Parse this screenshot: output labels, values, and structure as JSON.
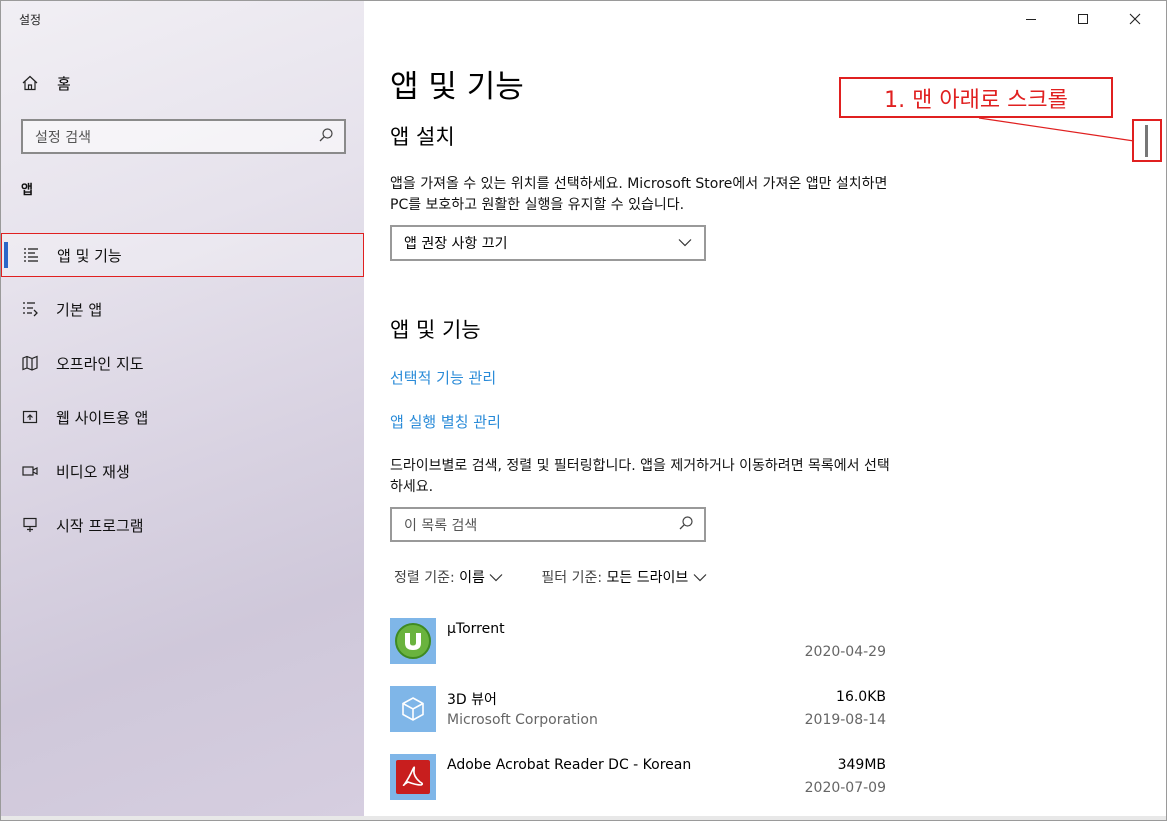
{
  "window": {
    "title": "설정",
    "controls": {
      "minimize": "—",
      "maximize": "☐",
      "close": "✕"
    }
  },
  "sidebar": {
    "home_label": "홈",
    "search_placeholder": "설정 검색",
    "section_label": "앱",
    "items": [
      {
        "label": "앱 및 기능",
        "icon": "apps-features-icon",
        "active": true
      },
      {
        "label": "기본 앱",
        "icon": "default-apps-icon"
      },
      {
        "label": "오프라인 지도",
        "icon": "offline-maps-icon"
      },
      {
        "label": "웹 사이트용 앱",
        "icon": "apps-for-websites-icon"
      },
      {
        "label": "비디오 재생",
        "icon": "video-playback-icon"
      },
      {
        "label": "시작 프로그램",
        "icon": "startup-icon"
      }
    ]
  },
  "main": {
    "title": "앱 및 기능",
    "install": {
      "heading": "앱 설치",
      "description": "앱을 가져올 수 있는 위치를 선택하세요. Microsoft Store에서 가져온 앱만 설치하면 PC를 보호하고 원활한 실행을 유지할 수 있습니다.",
      "dropdown_value": "앱 권장 사항 끄기"
    },
    "features": {
      "heading": "앱 및 기능",
      "link_optional": "선택적 기능 관리",
      "link_alias": "앱 실행 별칭 관리",
      "description": "드라이브별로 검색, 정렬 및 필터링합니다. 앱을 제거하거나 이동하려면 목록에서 선택하세요.",
      "search_placeholder": "이 목록 검색",
      "sort_label": "정렬 기준:",
      "sort_value": "이름",
      "filter_label": "필터 기준:",
      "filter_value": "모든 드라이브"
    },
    "apps": [
      {
        "name": "µTorrent",
        "publisher": "",
        "size": "",
        "date": "2020-04-29",
        "icon": "utorrent-icon"
      },
      {
        "name": "3D 뷰어",
        "publisher": "Microsoft Corporation",
        "size": "16.0KB",
        "date": "2019-08-14",
        "icon": "3d-viewer-icon"
      },
      {
        "name": "Adobe Acrobat Reader DC - Korean",
        "publisher": "",
        "size": "349MB",
        "date": "2020-07-09",
        "icon": "acrobat-icon"
      }
    ]
  },
  "annotation": {
    "text": "1. 맨 아래로 스크롤"
  },
  "colors": {
    "accent": "#2b67c8",
    "link": "#2a8bd8",
    "annotation": "#e02020",
    "tile": "#7fb6e8"
  }
}
